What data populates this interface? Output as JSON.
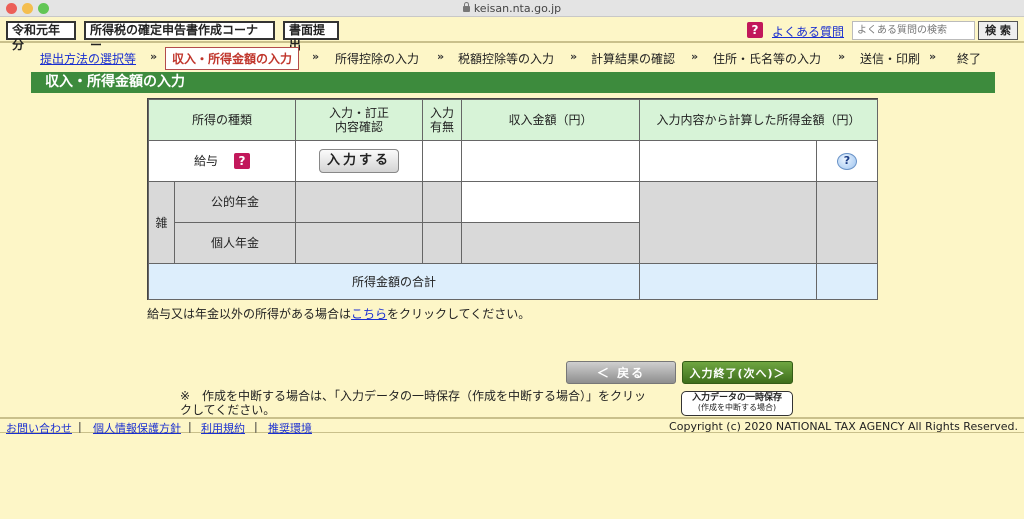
{
  "browser": {
    "url": "keisan.nta.go.jp"
  },
  "header": {
    "era": "令和元年分",
    "corner": "所得税の確定申告書作成コーナー",
    "submission": "書面提出",
    "faq_icon": "?",
    "faq_link": "よくある質問",
    "search_placeholder": "よくある質問の検索",
    "search_button": "検 索"
  },
  "steps": [
    {
      "label": "提出方法の選択等",
      "state": "link"
    },
    {
      "label": "収入・所得金額の入力",
      "state": "current"
    },
    {
      "label": "所得控除の入力",
      "state": "todo"
    },
    {
      "label": "税額控除等の入力",
      "state": "todo"
    },
    {
      "label": "計算結果の確認",
      "state": "todo"
    },
    {
      "label": "住所・氏名等の入力",
      "state": "todo"
    },
    {
      "label": "送信・印刷",
      "state": "todo"
    },
    {
      "label": "終了",
      "state": "todo"
    }
  ],
  "step_arrow": "»",
  "page_title": "収入・所得金額の入力",
  "table": {
    "headers": {
      "type": "所得の種類",
      "input": "入力・訂正\n内容確認",
      "presence": "入力\n有無",
      "income": "収入金額（円）",
      "calculated": "入力内容から計算した所得金額（円）"
    },
    "rows": {
      "salary": "給与",
      "salary_help": "?",
      "input_button": "入力する",
      "misc_group": "雑",
      "public_pension": "公的年金",
      "private_pension": "個人年金",
      "total": "所得金額の合計",
      "help_icon": "?"
    }
  },
  "note1": {
    "before": "給与又は年金以外の所得がある場合は",
    "link": "こちら",
    "after": "をクリックしてください。"
  },
  "buttons": {
    "back": "＜ 戻る",
    "next": "入力終了(次へ)＞",
    "save_line1": "入力データの一時保存",
    "save_line2": "(作成を中断する場合)"
  },
  "note2": "※　作成を中断する場合は、「入力データの一時保存（作成を中断する場合）」をクリックしてください。",
  "footer": {
    "links": [
      "お問い合わせ",
      "個人情報保護方針",
      "利用規約",
      "推奨環境"
    ],
    "separator": "|",
    "copyright": "Copyright (c) 2020 NATIONAL TAX AGENCY All Rights Reserved."
  }
}
